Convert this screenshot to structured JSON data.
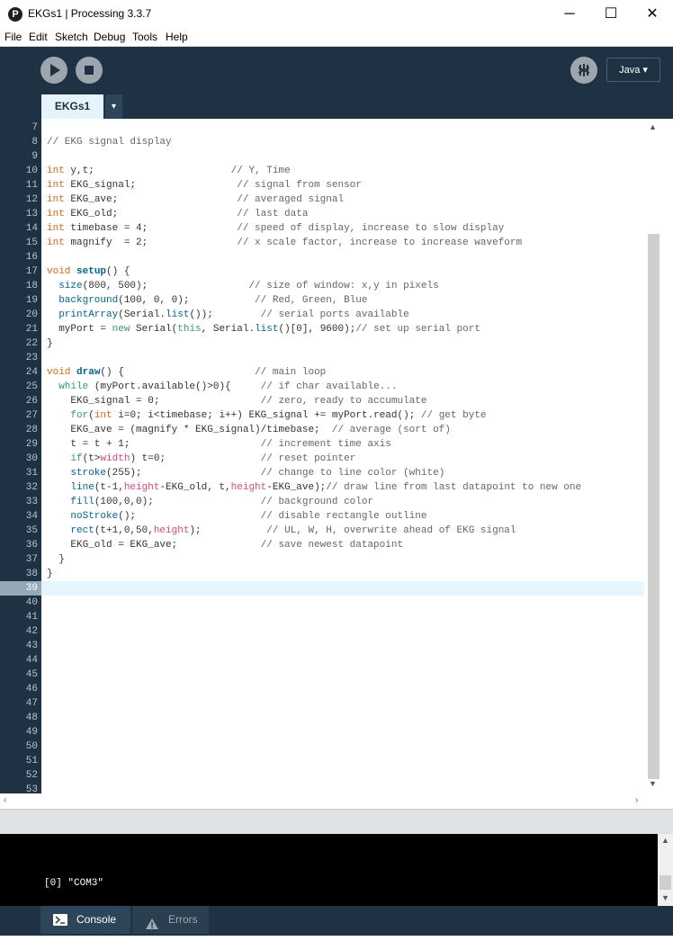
{
  "window": {
    "title": "EKGs1 | Processing 3.3.7",
    "icon_glyph": "P",
    "minimize_glyph": "─",
    "maximize_glyph": "☐",
    "close_glyph": "✕"
  },
  "menu": [
    "File",
    "Edit",
    "Sketch",
    "Debug",
    "Tools",
    "Help"
  ],
  "toolbar": {
    "run_icon": "play-icon",
    "stop_icon": "stop-icon",
    "debug_icon": "debugger-icon",
    "mode_label": "Java ▾"
  },
  "tabs": {
    "active": "EKGs1",
    "menu_glyph": "▾"
  },
  "editor": {
    "current_line": 39,
    "lines": [
      {
        "n": "7",
        "segs": []
      },
      {
        "n": "8",
        "segs": [
          {
            "t": "// EKG signal display",
            "c": "cmt"
          }
        ]
      },
      {
        "n": "9",
        "segs": []
      },
      {
        "n": "10",
        "segs": [
          {
            "t": "int",
            "c": "kw-type"
          },
          {
            "t": " y,t;                       "
          },
          {
            "t": "// Y, Time",
            "c": "cmt"
          }
        ]
      },
      {
        "n": "11",
        "segs": [
          {
            "t": "int",
            "c": "kw-type"
          },
          {
            "t": " EKG_signal;                 "
          },
          {
            "t": "// signal from sensor",
            "c": "cmt"
          }
        ]
      },
      {
        "n": "12",
        "segs": [
          {
            "t": "int",
            "c": "kw-type"
          },
          {
            "t": " EKG_ave;                    "
          },
          {
            "t": "// averaged signal",
            "c": "cmt"
          }
        ]
      },
      {
        "n": "13",
        "segs": [
          {
            "t": "int",
            "c": "kw-type"
          },
          {
            "t": " EKG_old;                    "
          },
          {
            "t": "// last data",
            "c": "cmt"
          }
        ]
      },
      {
        "n": "14",
        "segs": [
          {
            "t": "int",
            "c": "kw-type"
          },
          {
            "t": " timebase = 4;               "
          },
          {
            "t": "// speed of display, increase to slow display",
            "c": "cmt"
          }
        ]
      },
      {
        "n": "15",
        "segs": [
          {
            "t": "int",
            "c": "kw-type"
          },
          {
            "t": " magnify  = 2;               "
          },
          {
            "t": "// x scale factor, increase to increase waveform",
            "c": "cmt"
          }
        ]
      },
      {
        "n": "16",
        "segs": []
      },
      {
        "n": "17",
        "segs": [
          {
            "t": "void",
            "c": "kw-type"
          },
          {
            "t": " "
          },
          {
            "t": "setup",
            "c": "kw-bold"
          },
          {
            "t": "() {"
          }
        ]
      },
      {
        "n": "18",
        "segs": [
          {
            "t": "  "
          },
          {
            "t": "size",
            "c": "kw-fn"
          },
          {
            "t": "(800, 500);                 "
          },
          {
            "t": "// size of window: x,y in pixels",
            "c": "cmt"
          }
        ]
      },
      {
        "n": "19",
        "segs": [
          {
            "t": "  "
          },
          {
            "t": "background",
            "c": "kw-fn"
          },
          {
            "t": "(100, 0, 0);           "
          },
          {
            "t": "// Red, Green, Blue",
            "c": "cmt"
          }
        ]
      },
      {
        "n": "20",
        "segs": [
          {
            "t": "  "
          },
          {
            "t": "printArray",
            "c": "kw-fn"
          },
          {
            "t": "(Serial."
          },
          {
            "t": "list",
            "c": "kw-fn"
          },
          {
            "t": "());        "
          },
          {
            "t": "// serial ports available",
            "c": "cmt"
          }
        ]
      },
      {
        "n": "21",
        "segs": [
          {
            "t": "  myPort = "
          },
          {
            "t": "new",
            "c": "kw-lit"
          },
          {
            "t": " Serial("
          },
          {
            "t": "this",
            "c": "kw-lit"
          },
          {
            "t": ", Serial."
          },
          {
            "t": "list",
            "c": "kw-fn"
          },
          {
            "t": "()[0], 9600);"
          },
          {
            "t": "// set up serial port",
            "c": "cmt"
          }
        ]
      },
      {
        "n": "22",
        "segs": [
          {
            "t": "}"
          }
        ]
      },
      {
        "n": "23",
        "segs": []
      },
      {
        "n": "24",
        "segs": [
          {
            "t": "void",
            "c": "kw-type"
          },
          {
            "t": " "
          },
          {
            "t": "draw",
            "c": "kw-bold"
          },
          {
            "t": "() {                      "
          },
          {
            "t": "// main loop",
            "c": "cmt"
          }
        ]
      },
      {
        "n": "25",
        "segs": [
          {
            "t": "  "
          },
          {
            "t": "while",
            "c": "kw-lit"
          },
          {
            "t": " (myPort.available()>0){     "
          },
          {
            "t": "// if char available...",
            "c": "cmt"
          }
        ]
      },
      {
        "n": "26",
        "segs": [
          {
            "t": "    EKG_signal = 0;                 "
          },
          {
            "t": "// zero, ready to accumulate",
            "c": "cmt"
          }
        ]
      },
      {
        "n": "27",
        "segs": [
          {
            "t": "    "
          },
          {
            "t": "for",
            "c": "kw-lit"
          },
          {
            "t": "("
          },
          {
            "t": "int",
            "c": "kw-type"
          },
          {
            "t": " i=0; i<timebase; i++) EKG_signal += myPort.read(); "
          },
          {
            "t": "// get byte",
            "c": "cmt"
          }
        ]
      },
      {
        "n": "28",
        "segs": [
          {
            "t": "    EKG_ave = (magnify * EKG_signal)/timebase;  "
          },
          {
            "t": "// average (sort of)",
            "c": "cmt"
          }
        ]
      },
      {
        "n": "29",
        "segs": [
          {
            "t": "    t = t + 1;                      "
          },
          {
            "t": "// increment time axis",
            "c": "cmt"
          }
        ]
      },
      {
        "n": "30",
        "segs": [
          {
            "t": "    "
          },
          {
            "t": "if",
            "c": "kw-lit"
          },
          {
            "t": "(t>"
          },
          {
            "t": "width",
            "c": "kw-var"
          },
          {
            "t": ") t=0;                "
          },
          {
            "t": "// reset pointer",
            "c": "cmt"
          }
        ]
      },
      {
        "n": "31",
        "segs": [
          {
            "t": "    "
          },
          {
            "t": "stroke",
            "c": "kw-fn"
          },
          {
            "t": "(255);                    "
          },
          {
            "t": "// change to line color (white)",
            "c": "cmt"
          }
        ]
      },
      {
        "n": "32",
        "segs": [
          {
            "t": "    "
          },
          {
            "t": "line",
            "c": "kw-fn"
          },
          {
            "t": "(t-1,"
          },
          {
            "t": "height",
            "c": "kw-var"
          },
          {
            "t": "-EKG_old, t,"
          },
          {
            "t": "height",
            "c": "kw-var"
          },
          {
            "t": "-EKG_ave);"
          },
          {
            "t": "// draw line from last datapoint to new one",
            "c": "cmt"
          }
        ]
      },
      {
        "n": "33",
        "segs": [
          {
            "t": "    "
          },
          {
            "t": "fill",
            "c": "kw-fn"
          },
          {
            "t": "(100,0,0);                  "
          },
          {
            "t": "// background color",
            "c": "cmt"
          }
        ]
      },
      {
        "n": "34",
        "segs": [
          {
            "t": "    "
          },
          {
            "t": "noStroke",
            "c": "kw-fn"
          },
          {
            "t": "();                     "
          },
          {
            "t": "// disable rectangle outline",
            "c": "cmt"
          }
        ]
      },
      {
        "n": "35",
        "segs": [
          {
            "t": "    "
          },
          {
            "t": "rect",
            "c": "kw-fn"
          },
          {
            "t": "(t+1,0,50,"
          },
          {
            "t": "height",
            "c": "kw-var"
          },
          {
            "t": ");           "
          },
          {
            "t": "// UL, W, H, overwrite ahead of EKG signal",
            "c": "cmt"
          }
        ]
      },
      {
        "n": "36",
        "segs": [
          {
            "t": "    EKG_old = EKG_ave;              "
          },
          {
            "t": "// save newest datapoint",
            "c": "cmt"
          }
        ]
      },
      {
        "n": "37",
        "segs": [
          {
            "t": "  }"
          }
        ]
      },
      {
        "n": "38",
        "segs": [
          {
            "t": "}"
          }
        ]
      },
      {
        "n": "39",
        "segs": []
      },
      {
        "n": "40",
        "segs": []
      },
      {
        "n": "41",
        "segs": []
      },
      {
        "n": "42",
        "segs": []
      },
      {
        "n": "43",
        "segs": []
      },
      {
        "n": "44",
        "segs": []
      },
      {
        "n": "45",
        "segs": []
      },
      {
        "n": "46",
        "segs": []
      },
      {
        "n": "47",
        "segs": []
      },
      {
        "n": "48",
        "segs": []
      },
      {
        "n": "49",
        "segs": []
      },
      {
        "n": "50",
        "segs": []
      },
      {
        "n": "51",
        "segs": []
      },
      {
        "n": "52",
        "segs": []
      },
      {
        "n": "53",
        "segs": []
      }
    ]
  },
  "console": {
    "output": "[0] \"COM3\""
  },
  "footer": {
    "console_label": "Console",
    "errors_label": "Errors",
    "console_icon": "terminal-icon",
    "errors_icon": "warning-icon"
  },
  "colors": {
    "header_bg": "#1e3243",
    "tab_active_bg": "#e5f3fd",
    "current_line_bg": "#e7f5fe",
    "current_line_gutter": "#96a9b8"
  }
}
